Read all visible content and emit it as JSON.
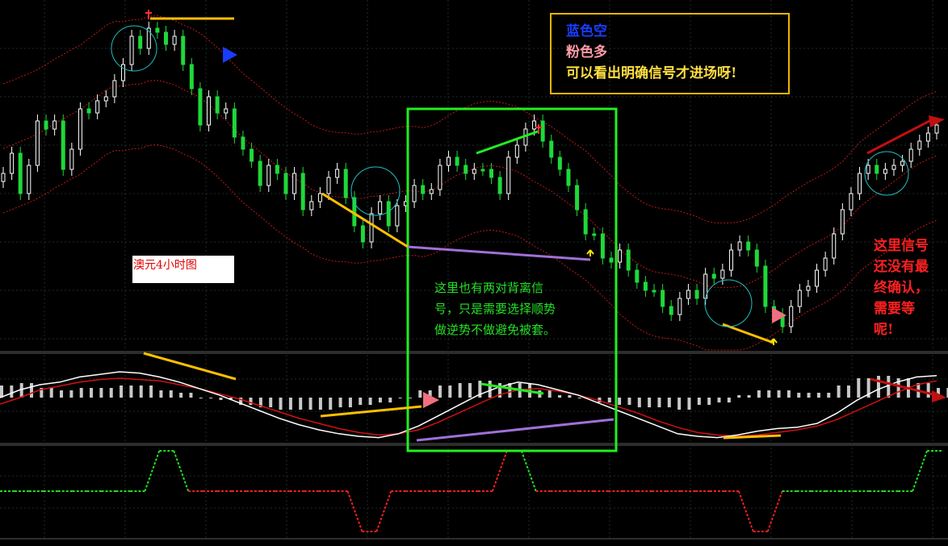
{
  "legend": {
    "blue_label": "蓝色空",
    "pink_label": "粉色多",
    "note": "可以看出明确信号才进场呀!",
    "colors": {
      "blue": "#1a3cff",
      "pink": "#ff9aa8",
      "note": "#ffe040",
      "border": "#f0b400"
    }
  },
  "chart_label": "澳元4小时图",
  "annotation_middle": [
    "这里也有两对背离信",
    "号，只是需要选择顺势",
    "做逆势不做避免被套。"
  ],
  "annotation_right": [
    "这里信号",
    "还没有最",
    "终确认，",
    "需要等",
    "呢!"
  ],
  "colors": {
    "background": "#000000",
    "candle_up": "#ffffff",
    "candle_down": "#1fd83a",
    "bands": "#c01818",
    "macd_line": "#ffffff",
    "signal_line": "#d41010",
    "histogram": "#c8c8c8",
    "indicator_up": "#22dd22",
    "indicator_down": "#ee2020",
    "highlight_box": "#22ee22",
    "trend_yellow": "#ffc000",
    "trend_purple": "#a070d8",
    "trend_green": "#22ee22",
    "trend_red": "#c01010",
    "circle": "#20c0c0"
  },
  "icons": {
    "buy_arrow": "pink-triangle-right",
    "sell_arrow": "blue-triangle-right",
    "fractal": "yellow-arrow-up"
  },
  "chart_data": [
    {
      "type": "candlestick",
      "title": "澳元4小时图",
      "overlays": [
        "bollinger bands (dotted)"
      ],
      "series": [
        {
          "values": [
            215,
            190,
            240,
            205,
            150,
            160,
            150,
            210,
            185,
            135,
            140,
            125,
            120,
            100,
            80,
            45,
            60,
            35,
            40,
            55,
            45,
            80,
            110,
            155,
            120,
            140,
            135,
            170,
            185,
            200,
            230,
            205,
            215,
            240,
            215,
            260,
            250,
            240,
            220,
            210,
            245,
            280,
            300,
            265,
            250,
            280,
            255,
            250,
            230,
            240,
            235,
            205,
            195,
            205,
            215,
            210,
            210,
            220,
            240,
            195,
            180,
            160,
            150,
            175,
            195,
            210,
            230,
            260,
            290,
            290,
            320,
            325,
            310,
            335,
            350,
            360,
            360,
            380,
            390,
            370,
            360,
            370,
            340,
            345,
            335,
            310,
            300,
            310,
            330,
            380,
            390,
            405,
            380,
            360,
            355,
            335,
            320,
            290,
            260,
            240,
            215,
            205,
            215,
            210,
            205,
            200,
            185,
            175,
            165,
            155
          ]
        }
      ]
    },
    {
      "type": "line",
      "series": [
        {
          "name": "MACD",
          "values": [
            0.0,
            0.6,
            1.0,
            1.2,
            1.6,
            1.8,
            2.0,
            1.9,
            1.6,
            1.2,
            0.7,
            0.2,
            -0.4,
            -1.0,
            -1.6,
            -2.1,
            -2.5,
            -2.8,
            -3.0,
            -3.1,
            -2.8,
            -2.2,
            -1.4,
            -0.6,
            0.2,
            0.8,
            1.2,
            1.0,
            0.6,
            0.2,
            -0.4,
            -1.0,
            -1.6,
            -2.2,
            -2.8,
            -3.0,
            -3.1,
            -2.9,
            -2.6,
            -2.4,
            -2.3,
            -2.0,
            -1.2,
            -0.2,
            0.6,
            1.2,
            1.6,
            1.7
          ]
        },
        {
          "name": "Signal",
          "values": [
            -0.5,
            0.0,
            0.6,
            0.9,
            1.2,
            1.4,
            1.5,
            1.4,
            1.3,
            1.0,
            0.7,
            0.3,
            -0.1,
            -0.6,
            -1.1,
            -1.6,
            -2.0,
            -2.4,
            -2.7,
            -2.9,
            -2.8,
            -2.5,
            -1.9,
            -1.2,
            -0.5,
            0.2,
            0.6,
            0.7,
            0.5,
            0.2,
            -0.2,
            -0.7,
            -1.2,
            -1.8,
            -2.3,
            -2.7,
            -2.9,
            -3.0,
            -2.9,
            -2.7,
            -2.5,
            -2.2,
            -1.7,
            -1.0,
            -0.3,
            0.4,
            1.0,
            1.3
          ]
        },
        {
          "name": "Histogram",
          "values": [
            0.5,
            0.6,
            0.4,
            0.3,
            0.4,
            0.4,
            0.5,
            0.5,
            0.3,
            0.2,
            0.0,
            -0.1,
            -0.3,
            -0.4,
            -0.5,
            -0.5,
            -0.5,
            -0.4,
            -0.3,
            -0.2,
            0.0,
            0.3,
            0.5,
            0.6,
            0.7,
            0.6,
            0.6,
            0.3,
            0.1,
            0.0,
            -0.2,
            -0.3,
            -0.4,
            -0.4,
            -0.5,
            -0.3,
            -0.2,
            0.1,
            0.3,
            0.3,
            0.2,
            0.2,
            0.5,
            0.8,
            0.9,
            0.8,
            0.6,
            0.4
          ]
        }
      ]
    },
    {
      "type": "line",
      "series": [
        {
          "values": [
            0,
            0,
            0,
            0,
            0,
            0,
            0,
            0,
            0,
            0,
            0,
            1,
            1,
            0,
            0,
            0,
            0,
            0,
            0,
            0,
            0,
            0,
            0,
            0,
            0,
            -1,
            -1,
            0,
            0,
            0,
            0,
            0,
            0,
            0,
            0,
            1,
            1,
            0,
            0,
            0,
            0,
            0,
            0,
            0,
            0,
            0,
            0,
            0,
            0,
            0,
            0,
            0,
            -1,
            -1,
            0,
            0,
            0,
            0,
            0,
            0,
            0,
            0,
            0,
            0,
            1,
            1
          ]
        }
      ]
    }
  ]
}
